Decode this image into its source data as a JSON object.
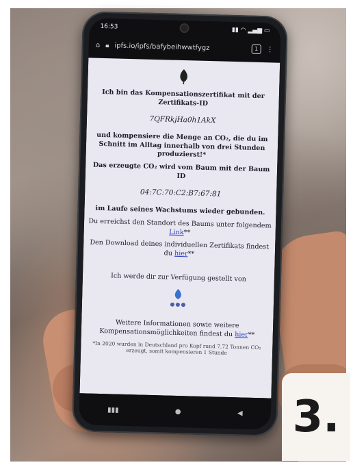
{
  "status_bar": {
    "time": "16:53",
    "indicators": "wifi-signal-battery"
  },
  "browser": {
    "url": "ipfs.io/ipfs/bafybeihwwtfygz",
    "tab_count": "1"
  },
  "certificate": {
    "intro": "Ich bin das Kompensationszertifikat mit der Zertifikats-ID",
    "certificate_id": "7QFRkjHa0h1AkX",
    "compensation_text": "und kompensiere die Menge an CO₂, die du im Schnitt im Alltag innerhalb von drei Stunden produzierst!*",
    "tree_text": "Das erzeugte CO₂ wird vom Baum mit der Baum ID",
    "tree_id": "04:7C:70:C2:B7:67:81",
    "bound_text": "im Laufe seines Wachstums wieder gebunden.",
    "location_text": "Du erreichst den Standort des Baums unter folgendem",
    "location_link": "Link",
    "location_suffix": "**",
    "download_text": "Den Download deines individuellen Zertifikats findest du",
    "download_link": "hier",
    "download_suffix": "**",
    "provided_by": "Ich werde dir zur Verfügung gestellt von",
    "more_info_text": "Weitere Informationen sowie weitere Kompensationsmöglichkeiten findest du",
    "more_info_link": "hier",
    "more_info_suffix": "**",
    "footnote": "*In 2020 wurden in Deutschland pro Kopf rund 7,72 Tonnen CO₂ erzeugt, somit kompensieren 1 Stunde"
  },
  "badge": {
    "label": "3."
  },
  "colors": {
    "page_background": "#e9e7f0",
    "link": "#2a3fc0",
    "phone_body": "#1c1d20",
    "badge_background": "#f7f3ee"
  }
}
